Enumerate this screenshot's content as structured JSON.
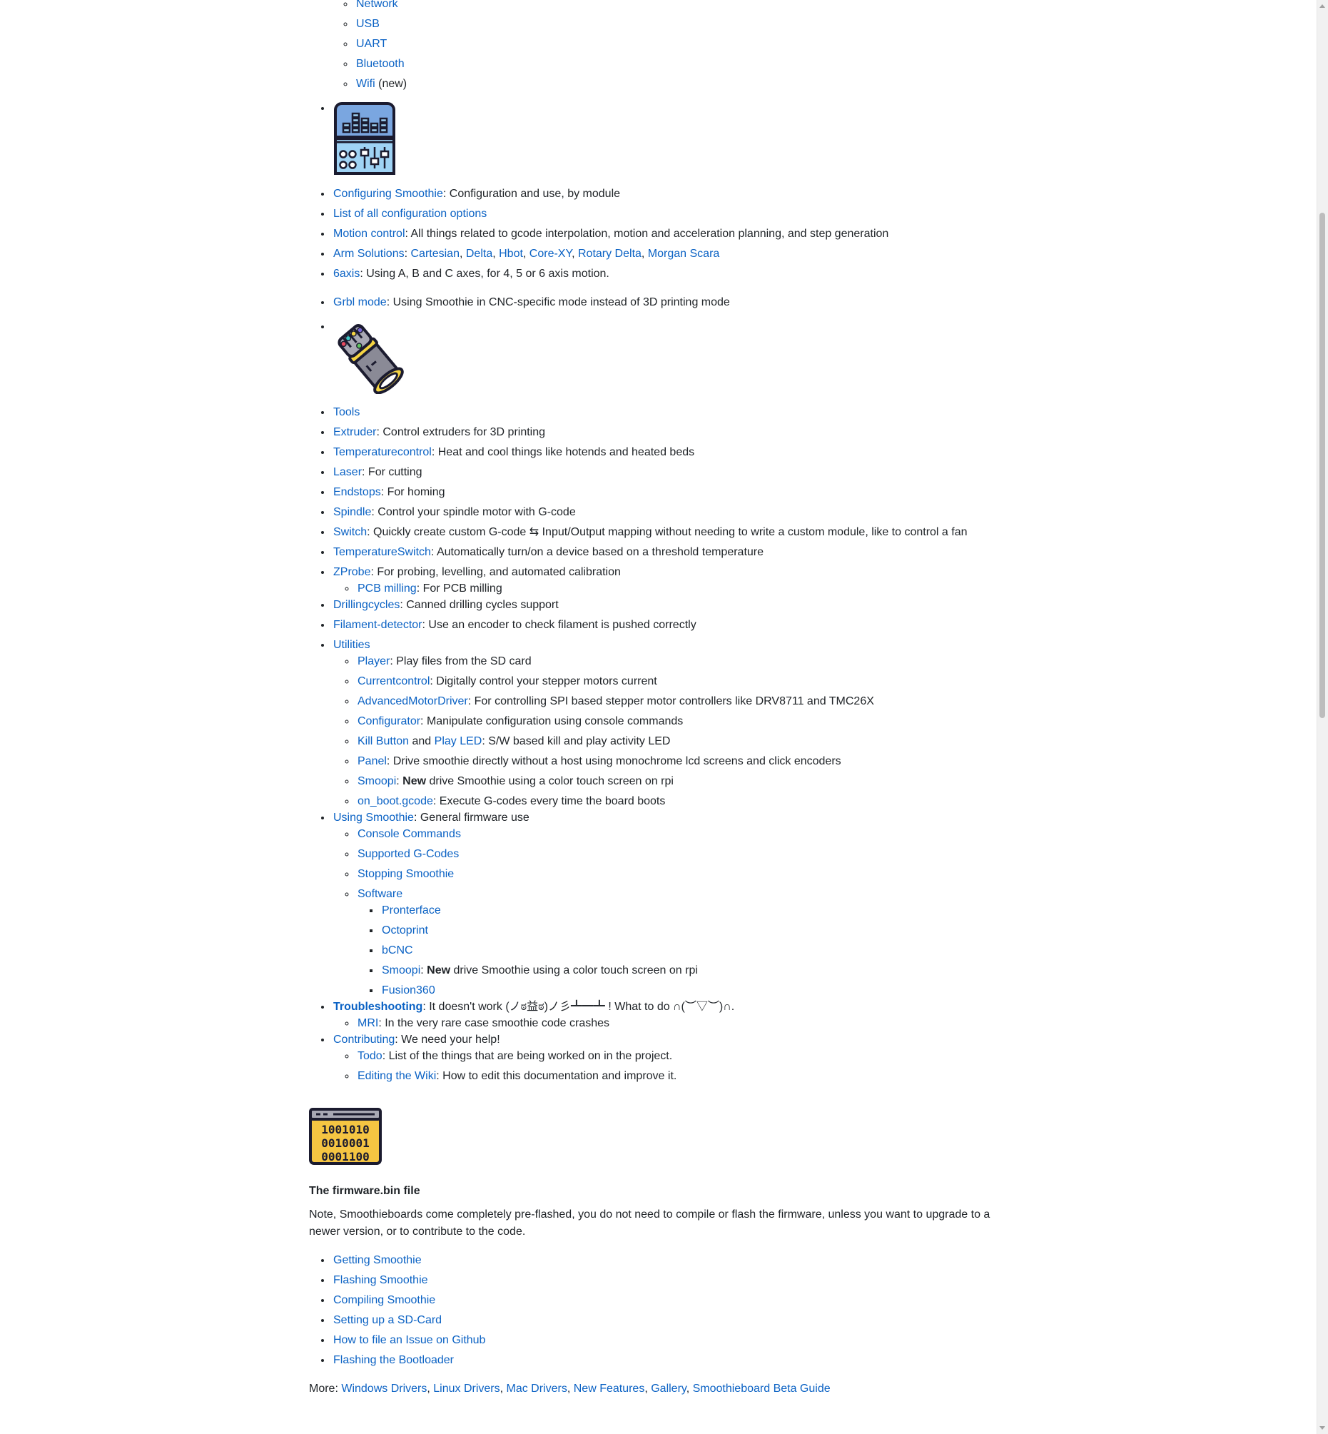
{
  "top_list": [
    "Network",
    "USB",
    "UART",
    "Bluetooth",
    "Wifi"
  ],
  "wifi_suffix": "(new)",
  "config": {
    "configuring": {
      "link": "Configuring Smoothie",
      "text": ": Configuration and use, by module"
    },
    "options_link": "List of all configuration options",
    "motion": {
      "link": "Motion control",
      "text": ": All things related to gcode interpolation, motion and acceleration planning, and step generation"
    },
    "arm": {
      "link": "Arm Solutions",
      "items": [
        "Cartesian",
        "Delta",
        "Hbot",
        "Core-XY",
        "Rotary Delta",
        "Morgan Scara"
      ]
    },
    "sixaxis": {
      "link": "6axis",
      "text": ": Using A, B and C axes, for 4, 5 or 6 axis motion."
    },
    "grbl": {
      "link": "Grbl mode",
      "text": ": Using Smoothie in CNC-specific mode instead of 3D printing mode"
    }
  },
  "tools": {
    "tools_link": "Tools",
    "extruder": {
      "link": "Extruder",
      "text": ": Control extruders for 3D printing"
    },
    "temperaturecontrol": {
      "link": "Temperaturecontrol",
      "text": ": Heat and cool things like hotends and heated beds"
    },
    "laser": {
      "link": "Laser",
      "text": ": For cutting"
    },
    "endstops": {
      "link": "Endstops",
      "text": ": For homing"
    },
    "spindle": {
      "link": "Spindle",
      "text": ": Control your spindle motor with G-code"
    },
    "switch": {
      "link": "Switch",
      "text": ": Quickly create custom G-code ⇆ Input/Output mapping without needing to write a custom module, like to control a fan"
    },
    "temperatureswitch": {
      "link": "TemperatureSwitch",
      "text": ": Automatically turn/on a device based on a threshold temperature"
    },
    "zprobe": {
      "link": "ZProbe",
      "text": ": For probing, levelling, and automated calibration"
    },
    "pcb": {
      "link": "PCB milling",
      "text": ": For PCB milling"
    },
    "drilling": {
      "link": "Drillingcycles",
      "text": ": Canned drilling cycles support"
    },
    "filament": {
      "link": "Filament-detector",
      "text": ": Use an encoder to check filament is pushed correctly"
    },
    "utilities": {
      "link": "Utilities",
      "player": {
        "link": "Player",
        "text": ": Play files from the SD card"
      },
      "currentcontrol": {
        "link": "Currentcontrol",
        "text": ": Digitally control your stepper motors current"
      },
      "advanced": {
        "link": "AdvancedMotorDriver",
        "text": ": For controlling SPI based stepper motor controllers like DRV8711 and TMC26X"
      },
      "configurator": {
        "link": "Configurator",
        "text": ": Manipulate configuration using console commands"
      },
      "kill": {
        "link1": "Kill Button",
        "and": " and ",
        "link2": "Play LED",
        "text": ": S/W based kill and play activity LED"
      },
      "panel": {
        "link": "Panel",
        "text": ": Drive smoothie directly without a host using monochrome lcd screens and click encoders"
      },
      "smoopi": {
        "link": "Smoopi",
        "sep": ": ",
        "bold": "New",
        "text": " drive Smoothie using a color touch screen on rpi"
      },
      "onboot": {
        "link": "on_boot.gcode",
        "text": ": Execute G-codes every time the board boots"
      }
    },
    "using": {
      "link": "Using Smoothie",
      "text": ": General firmware use",
      "console": "Console Commands",
      "gcodes": "Supported G-Codes",
      "stopping": "Stopping Smoothie",
      "software": {
        "link": "Software",
        "pronterface": "Pronterface",
        "octoprint": "Octoprint",
        "bcnc": "bCNC",
        "smoopi": {
          "link": "Smoopi",
          "sep": ": ",
          "bold": "New",
          "text": " drive Smoothie using a color touch screen on rpi"
        },
        "fusion": "Fusion360"
      }
    },
    "troubleshooting": {
      "link": "Troubleshooting",
      "text": ": It doesn't work (ノಠ益ಠ)ノ彡┻━┻ ! What to do ∩(︶▽︶)∩.",
      "mri": {
        "link": "MRI",
        "text": ": In the very rare case smoothie code crashes"
      }
    },
    "contributing": {
      "link": "Contributing",
      "text": ": We need your help!",
      "todo": {
        "link": "Todo",
        "text": ": List of the things that are being worked on in the project."
      },
      "editing": {
        "link": "Editing the Wiki",
        "text": ": How to edit this documentation and improve it."
      }
    }
  },
  "firmware": {
    "binary_lines": [
      "1001010",
      "0010001",
      "0001100"
    ],
    "heading": "The firmware.bin file",
    "note": "Note, Smoothieboards come completely pre-flashed, you do not need to compile or flash the firmware, unless you want to upgrade to a newer version, or to contribute to the code.",
    "links": [
      "Getting Smoothie",
      "Flashing Smoothie",
      "Compiling Smoothie",
      "Setting up a SD-Card",
      "How to file an Issue on Github",
      "Flashing the Bootloader"
    ]
  },
  "more": {
    "label": "More: ",
    "links": [
      "Windows Drivers",
      "Linux Drivers",
      "Mac Drivers",
      "New Features",
      "Gallery",
      "Smoothieboard Beta Guide"
    ]
  },
  "colors": {
    "link": "#0b62c4",
    "text": "#212529",
    "console_blue": "#7aa6e0",
    "console_light": "#9fd3f5",
    "binary_yellow": "#f5c542"
  }
}
